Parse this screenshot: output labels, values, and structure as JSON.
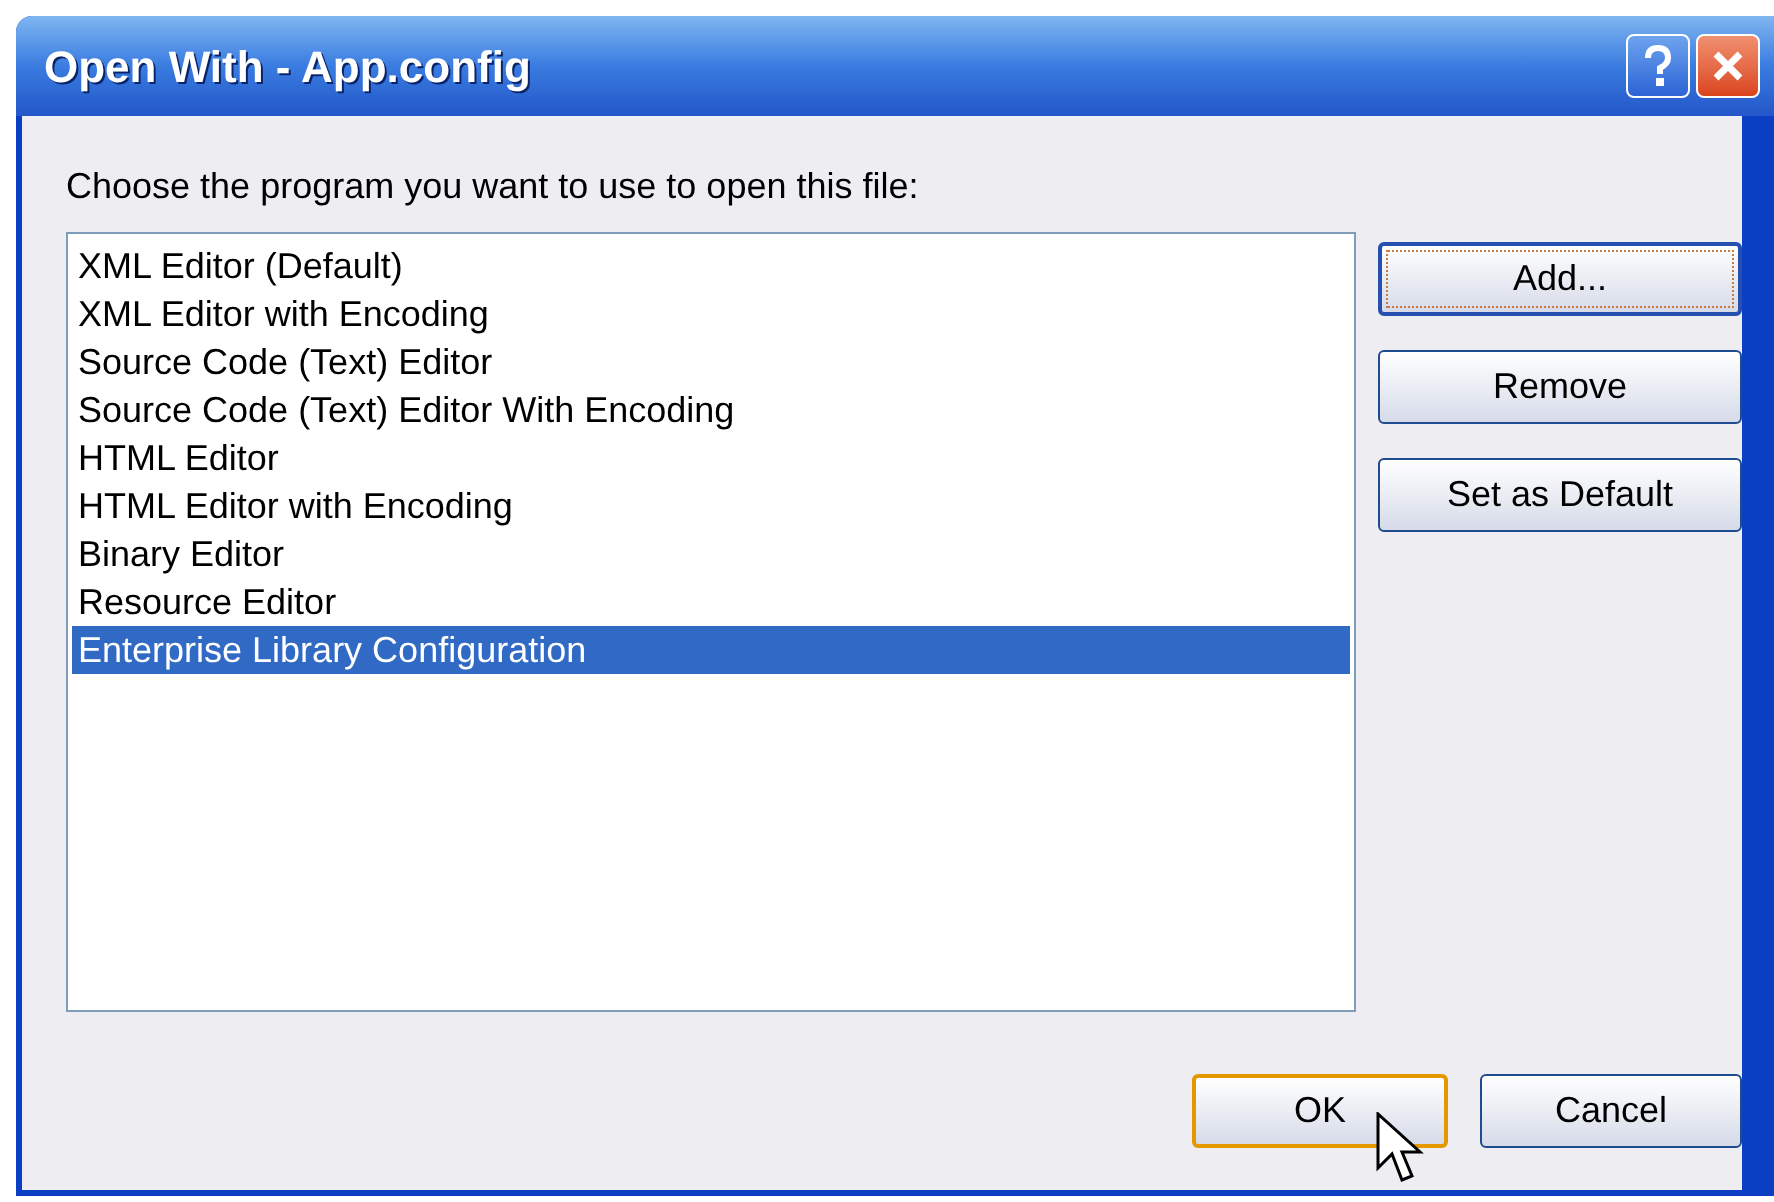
{
  "window": {
    "title": "Open With - App.config"
  },
  "prompt": "Choose the program you want to use to open this file:",
  "programs": [
    {
      "label": "XML Editor (Default)",
      "selected": false
    },
    {
      "label": "XML Editor with Encoding",
      "selected": false
    },
    {
      "label": "Source Code (Text) Editor",
      "selected": false
    },
    {
      "label": "Source Code (Text) Editor With Encoding",
      "selected": false
    },
    {
      "label": "HTML Editor",
      "selected": false
    },
    {
      "label": "HTML Editor with Encoding",
      "selected": false
    },
    {
      "label": "Binary Editor",
      "selected": false
    },
    {
      "label": "Resource Editor",
      "selected": false
    },
    {
      "label": "Enterprise Library Configuration",
      "selected": true
    }
  ],
  "side_buttons": [
    {
      "label": "Add...",
      "focused": true
    },
    {
      "label": "Remove",
      "focused": false
    },
    {
      "label": "Set as Default",
      "focused": false
    }
  ],
  "footer_buttons": [
    {
      "label": "OK",
      "hovered": true
    },
    {
      "label": "Cancel",
      "hovered": false
    }
  ]
}
